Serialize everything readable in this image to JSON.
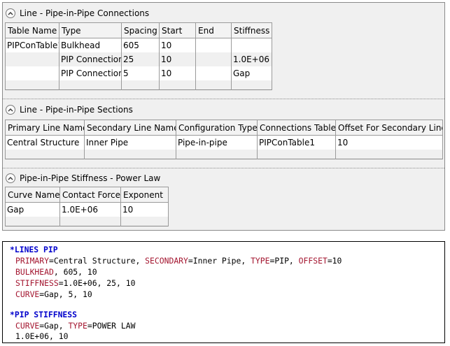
{
  "sections": {
    "connections": {
      "title": "Line - Pipe-in-Pipe Connections",
      "columns": [
        "Table Name",
        "Type",
        "Spacing",
        "Start",
        "End",
        "Stiffness"
      ],
      "rows": [
        [
          "PIPConTable1",
          "Bulkhead",
          "605",
          "10",
          "",
          ""
        ],
        [
          "",
          "PIP Connection",
          "25",
          "10",
          "",
          "1.0E+06"
        ],
        [
          "",
          "PIP Connection",
          "5",
          "10",
          "",
          "Gap"
        ]
      ]
    },
    "pip_sections": {
      "title": "Line - Pipe-in-Pipe Sections",
      "columns": [
        "Primary Line Name",
        "Secondary Line Name",
        "Configuration Type",
        "Connections Table",
        "Offset For Secondary Line"
      ],
      "rows": [
        [
          "Central Structure",
          "Inner Pipe",
          "Pipe-in-pipe",
          "PIPConTable1",
          "10"
        ]
      ]
    },
    "stiffness": {
      "title": "Pipe-in-Pipe Stiffness - Power Law",
      "columns": [
        "Curve Name",
        "Contact Force",
        "Exponent"
      ],
      "rows": [
        [
          "Gap",
          "1.0E+06",
          "10"
        ]
      ]
    }
  },
  "code": {
    "lines_header": "*LINES PIP",
    "line1": {
      "k1": "PRIMARY",
      "v1": "=Central Structure, ",
      "k2": "SECONDARY",
      "v2": "=Inner Pipe, ",
      "k3": "TYPE",
      "v3": "=PIP, ",
      "k4": "OFFSET",
      "v4": "=10"
    },
    "line2": {
      "k1": "BULKHEAD",
      "v1": ", 605, 10"
    },
    "line3": {
      "k1": "STIFFNESS",
      "v1": "=1.0E+06, 25, 10"
    },
    "line4": {
      "k1": "CURVE",
      "v1": "=Gap, 5, 10"
    },
    "stiffness_header": "*PIP STIFFNESS",
    "line5": {
      "k1": "CURVE",
      "v1": "=Gap, ",
      "k2": "TYPE",
      "v2": "=POWER LAW"
    },
    "line6": "1.0E+06, 10"
  }
}
